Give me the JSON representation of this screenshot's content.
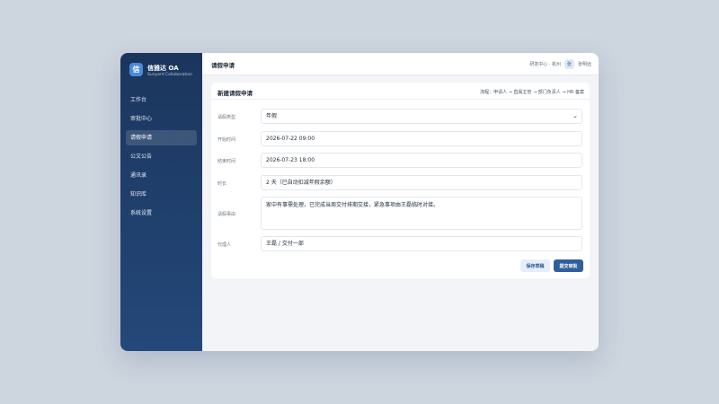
{
  "brand": {
    "logo_char": "信",
    "name": "信雅达 OA",
    "subtitle": "Sunyard Collaboration"
  },
  "sidebar": {
    "items": [
      {
        "label": "工作台"
      },
      {
        "label": "审批中心"
      },
      {
        "label": "请假申请",
        "active": true
      },
      {
        "label": "公文公告"
      },
      {
        "label": "通讯录"
      },
      {
        "label": "知识库"
      },
      {
        "label": "系统设置"
      }
    ]
  },
  "header": {
    "title": "请假申请",
    "org": "研发中心 · 杭州",
    "avatar_char": "张",
    "user": "张明远"
  },
  "form": {
    "title": "新建请假申请",
    "flow": "流程：申请人 → 直属主管 → 部门负责人 → HR 备案",
    "fields": {
      "leave_type": {
        "label": "请假类型",
        "value": "年假"
      },
      "start_time": {
        "label": "开始时间",
        "value": "2026-07-22 09:00"
      },
      "end_time": {
        "label": "结束时间",
        "value": "2026-07-23 18:00"
      },
      "duration": {
        "label": "时长",
        "value": "2 天（已自动扣减年假余额）"
      },
      "reason": {
        "label": "请假事由",
        "value": "家中有事需处理，已完成当周交付排期交接，紧急事项由王磊临时对接。"
      },
      "delegate": {
        "label": "代理人",
        "value": "王磊 / 交付一部"
      }
    },
    "buttons": {
      "save_draft": "保存草稿",
      "submit": "提交审批"
    }
  },
  "colors": {
    "sidebar": "#1b365d",
    "accent": "#2f5f9c",
    "background": "#cdd5df"
  }
}
